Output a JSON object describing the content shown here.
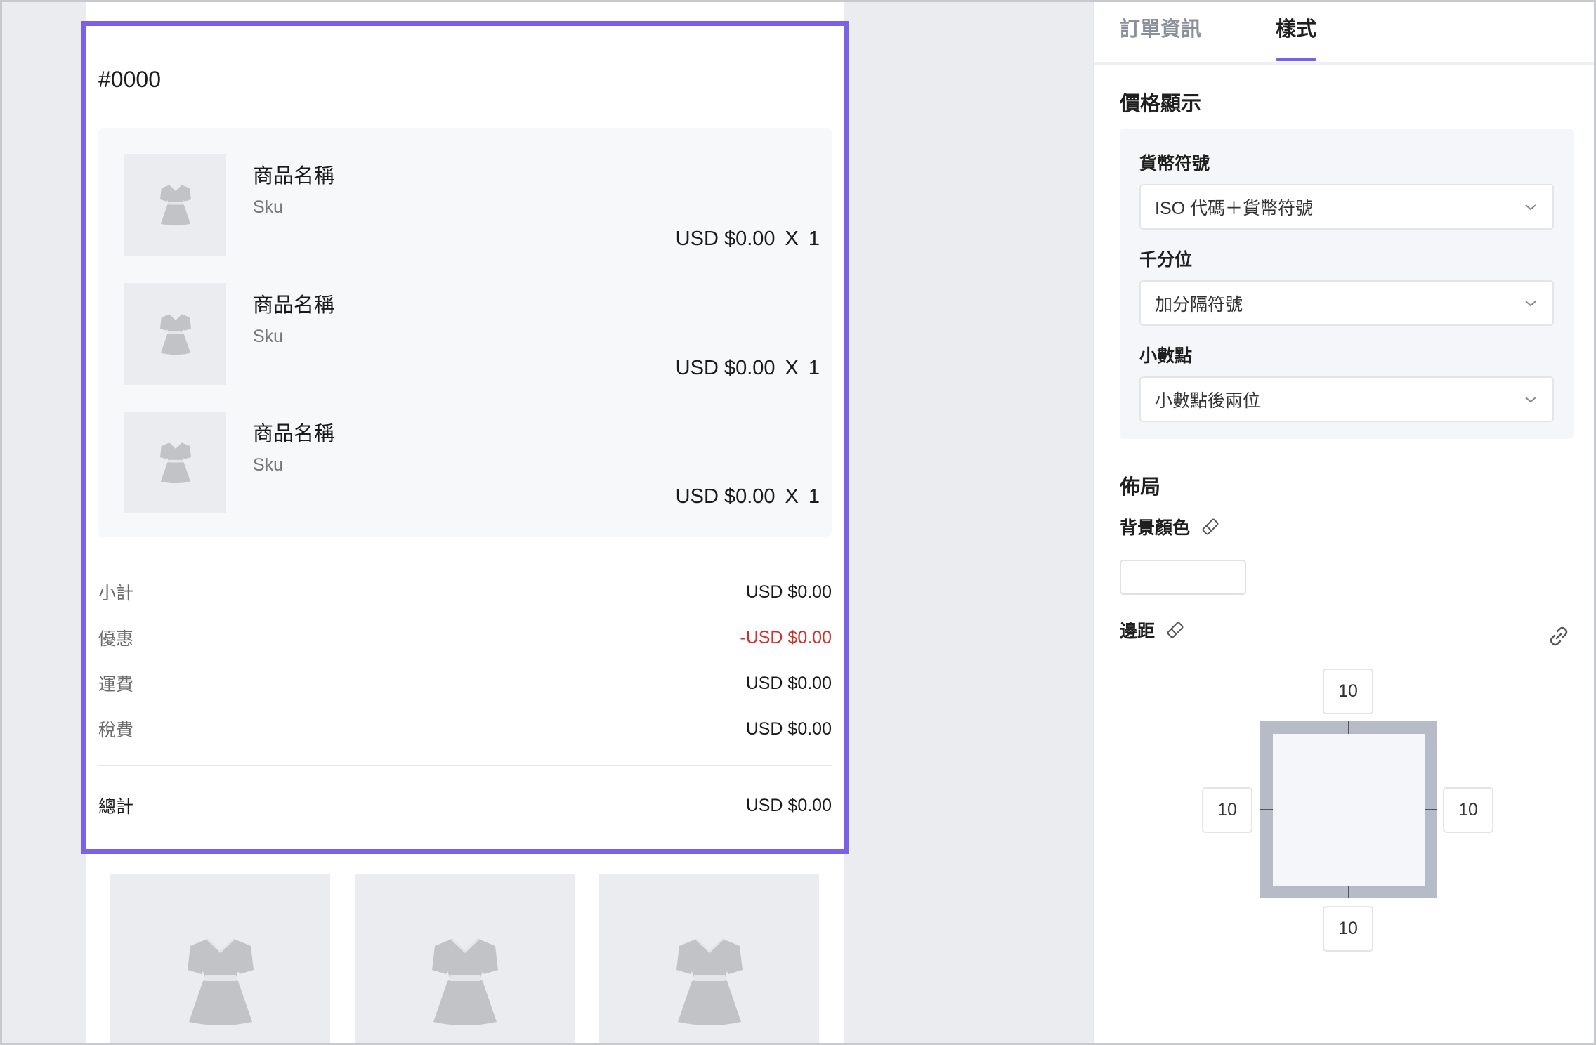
{
  "preview": {
    "order_number": "#0000",
    "items": [
      {
        "name": "商品名稱",
        "sku": "Sku",
        "price": "USD $0.00",
        "times": "X",
        "qty": "1"
      },
      {
        "name": "商品名稱",
        "sku": "Sku",
        "price": "USD $0.00",
        "times": "X",
        "qty": "1"
      },
      {
        "name": "商品名稱",
        "sku": "Sku",
        "price": "USD $0.00",
        "times": "X",
        "qty": "1"
      }
    ],
    "summary": [
      {
        "label": "小計",
        "value": "USD $0.00"
      },
      {
        "label": "優惠",
        "value": "-USD $0.00"
      },
      {
        "label": "運費",
        "value": "USD $0.00"
      },
      {
        "label": "稅費",
        "value": "USD $0.00"
      }
    ],
    "total": {
      "label": "總計",
      "value": "USD $0.00"
    }
  },
  "panel": {
    "tabs": [
      {
        "label": "訂單資訊",
        "active": false
      },
      {
        "label": "樣式",
        "active": true
      }
    ],
    "price_display": {
      "title": "價格顯示",
      "currency_label": "貨幣符號",
      "currency_value": "ISO 代碼＋貨幣符號",
      "thousands_label": "千分位",
      "thousands_value": "加分隔符號",
      "decimal_label": "小數點",
      "decimal_value": "小數點後兩位"
    },
    "layout": {
      "title": "佈局",
      "bg_color_label": "背景顏色",
      "padding_label": "邊距",
      "padding": {
        "top": "10",
        "right": "10",
        "bottom": "10",
        "left": "10"
      }
    }
  },
  "colors": {
    "accent": "#7b61e8",
    "discount": "#d0302a",
    "placeholder_bg": "#ebecef"
  },
  "icons": [
    "dress-icon",
    "chevron-down-icon",
    "eraser-icon",
    "link-icon"
  ]
}
